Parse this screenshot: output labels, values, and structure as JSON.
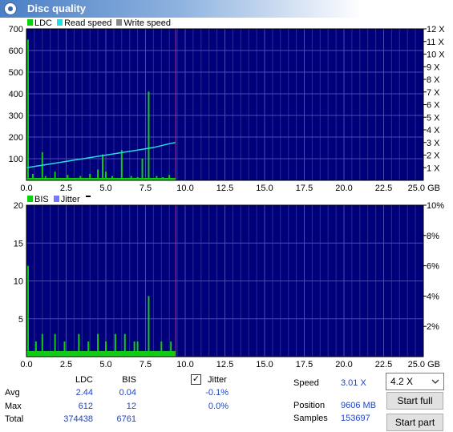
{
  "title": "Disc quality",
  "top_legend": {
    "ldc": "LDC",
    "read": "Read speed",
    "write": "Write speed"
  },
  "bottom_legend": {
    "bis": "BIS",
    "jitter": "Jitter"
  },
  "colors": {
    "ldc": "#11cc11",
    "read": "#22dddd",
    "write": "#888888",
    "bis": "#11cc11",
    "jitter": "#7777ff",
    "plot_bg": "#00007a",
    "marker": "#c0287a"
  },
  "chart_data": [
    {
      "type": "bar",
      "x_label_unit": "GB",
      "xlim": [
        0,
        25
      ],
      "x_ticks": [
        "0.0",
        "2.5",
        "5.0",
        "7.5",
        "10.0",
        "12.5",
        "15.0",
        "17.5",
        "20.0",
        "22.5",
        "25.0"
      ],
      "ylim_left": [
        0,
        700
      ],
      "y_ticks_left": [
        "100",
        "200",
        "300",
        "400",
        "500",
        "600",
        "700"
      ],
      "ylim_right": [
        0,
        12
      ],
      "y_ticks_right": [
        "1 X",
        "2 X",
        "3 X",
        "4 X",
        "5 X",
        "6 X",
        "7 X",
        "8 X",
        "9 X",
        "10 X",
        "11 X",
        "12 X"
      ],
      "data_end_gb": 9.4,
      "series": [
        {
          "name": "LDC",
          "x": [
            0.1,
            0.4,
            1.0,
            1.2,
            1.8,
            2.6,
            3.4,
            4.0,
            4.5,
            4.8,
            5.0,
            5.4,
            6.0,
            6.6,
            7.0,
            7.3,
            7.7,
            8.2,
            8.6,
            9.0
          ],
          "y": [
            650,
            30,
            130,
            20,
            40,
            25,
            20,
            30,
            50,
            120,
            40,
            20,
            140,
            20,
            15,
            100,
            410,
            20,
            15,
            25
          ]
        },
        {
          "name": "Read speed",
          "x": [
            0,
            1,
            2,
            3,
            4,
            5,
            6,
            7,
            8,
            9,
            9.4
          ],
          "y": [
            1.0,
            1.2,
            1.4,
            1.6,
            1.8,
            2.0,
            2.2,
            2.4,
            2.6,
            2.9,
            3.0
          ]
        }
      ]
    },
    {
      "type": "bar",
      "x_label_unit": "GB",
      "xlim": [
        0,
        25
      ],
      "x_ticks": [
        "0.0",
        "2.5",
        "5.0",
        "7.5",
        "10.0",
        "12.5",
        "15.0",
        "17.5",
        "20.0",
        "22.5",
        "25.0"
      ],
      "ylim_left": [
        0,
        20
      ],
      "y_ticks_left": [
        "5",
        "10",
        "15",
        "20"
      ],
      "ylim_right": [
        0,
        10
      ],
      "y_ticks_right": [
        "2%",
        "4%",
        "6%",
        "8%",
        "10%"
      ],
      "data_end_gb": 9.4,
      "series": [
        {
          "name": "BIS",
          "x": [
            0.1,
            0.6,
            1.0,
            1.8,
            2.4,
            3.3,
            3.9,
            4.5,
            5.0,
            5.6,
            6.2,
            6.8,
            7.0,
            7.7,
            8.5,
            9.1
          ],
          "y": [
            12,
            2,
            3,
            3,
            2,
            3,
            2,
            3,
            2,
            3,
            3,
            2,
            2,
            8,
            2,
            2
          ]
        }
      ]
    }
  ],
  "stats": {
    "col_ldc": "LDC",
    "col_bis": "BIS",
    "rows": [
      {
        "label": "Avg",
        "ldc": "2.44",
        "bis": "0.04",
        "jitter": "-0.1%"
      },
      {
        "label": "Max",
        "ldc": "612",
        "bis": "12",
        "jitter": "0.0%"
      },
      {
        "label": "Total",
        "ldc": "374438",
        "bis": "6761",
        "jitter": ""
      }
    ],
    "jitter_label": "Jitter",
    "jitter_checked": true
  },
  "info": {
    "speed_label": "Speed",
    "speed_value": "3.01 X",
    "position_label": "Position",
    "position_value": "9606 MB",
    "samples_label": "Samples",
    "samples_value": "153697"
  },
  "controls": {
    "speed_select": "4.2 X",
    "start_full": "Start full",
    "start_part": "Start part"
  }
}
